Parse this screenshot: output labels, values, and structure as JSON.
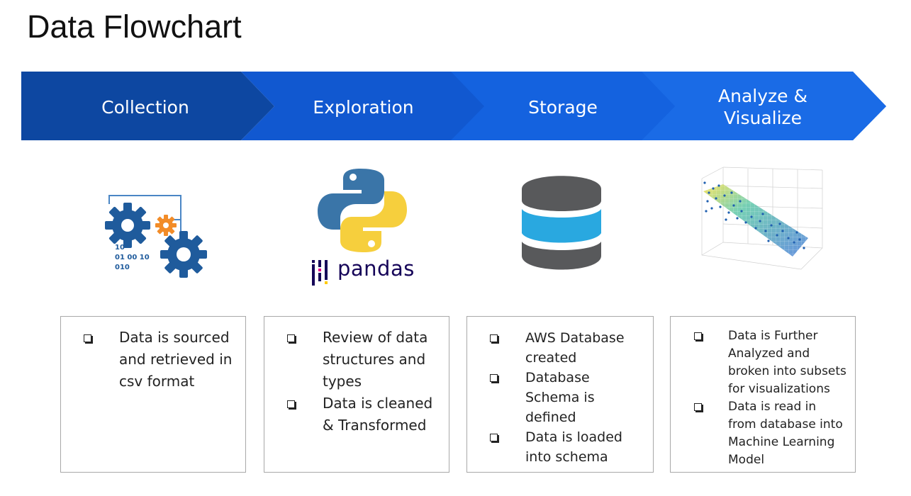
{
  "title": "Data Flowchart",
  "colors": {
    "stage1": "#0d47a1",
    "stage2": "#1158d0",
    "stage3": "#1462df",
    "stage4": "#1a6be6",
    "box_border": "#a8a8a8"
  },
  "stages": [
    {
      "label": "Collection",
      "icon": "gears-binary-icon",
      "items": [
        "Data is sourced and retrieved in csv format"
      ]
    },
    {
      "label": "Exploration",
      "icon": "python-pandas-logo",
      "logo_text": "pandas",
      "items": [
        "Review of data structures and types",
        "Data is cleaned & Transformed"
      ]
    },
    {
      "label": "Storage",
      "icon": "database-icon",
      "items": [
        "AWS Database created",
        "Database Schema is defined",
        "Data is loaded into schema"
      ]
    },
    {
      "label": "Analyze & Visualize",
      "label_lines": [
        "Analyze &",
        "Visualize"
      ],
      "icon": "3d-scatter-surface-plot-icon",
      "items": [
        "Data is Further Analyzed and broken into subsets for visualizations",
        "Data is read in from database into Machine Learning Model"
      ]
    }
  ]
}
